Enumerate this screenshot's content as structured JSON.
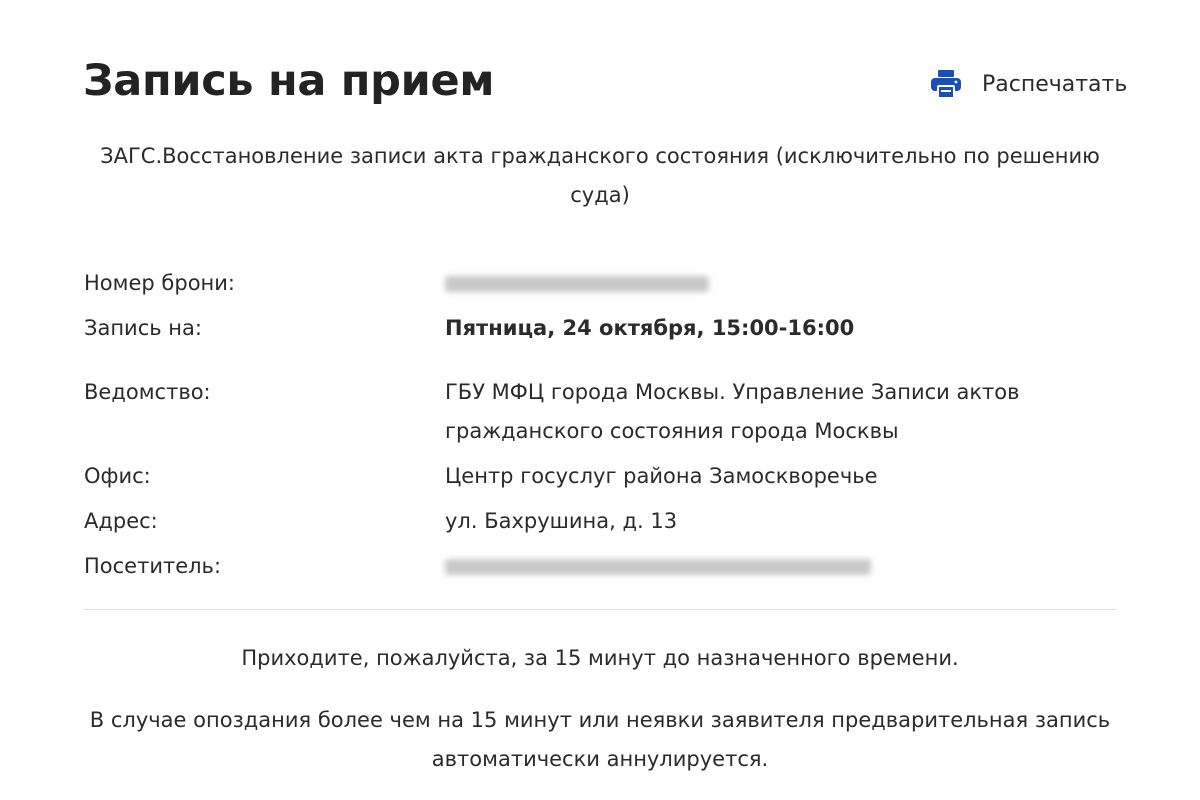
{
  "page": {
    "title": "Запись на прием",
    "print_label": "Распечатать",
    "service_title": "ЗАГС.Восстановление записи акта гражданского состояния (исключительно по решению суда)"
  },
  "details": {
    "booking_number_label": "Номер брони:",
    "booking_number_value": "",
    "appointment_label": "Запись на:",
    "appointment_value": "Пятница, 24 октября, 15:00-16:00",
    "agency_label": "Ведомство:",
    "agency_value": "ГБУ МФЦ города Москвы. Управление Записи актов гражданского состояния города Москвы",
    "office_label": "Офис:",
    "office_value": "Центр госуслуг района Замоскворечье",
    "address_label": "Адрес:",
    "address_value": "ул. Бахрушина, д. 13",
    "visitor_label": "Посетитель:",
    "visitor_value": ""
  },
  "notes": {
    "arrive_early": "Приходите, пожалуйста, за 15 минут до назначенного времени.",
    "late_policy": "В случае опоздания более чем на 15 минут или неявки заявителя предварительная запись автоматически аннулируется."
  },
  "icons": {
    "print": "printer-icon"
  },
  "colors": {
    "print_icon": "#1a4fb5",
    "text": "#2b2b2b",
    "divider": "#dcdcdc"
  }
}
